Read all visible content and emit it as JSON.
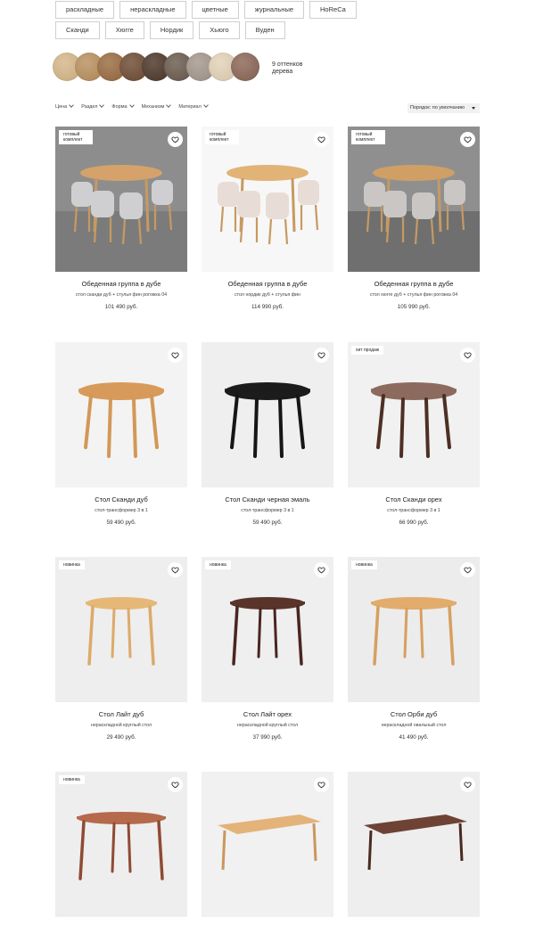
{
  "tags_row1": [
    "раскладные",
    "нераскладные",
    "цветные",
    "журнальные",
    "HoReCa"
  ],
  "tags_row2": [
    "Сканди",
    "Хюгге",
    "Нордик",
    "Хьюго",
    "Вуден"
  ],
  "swatches": {
    "colors": [
      "#d6b688",
      "#b98f5e",
      "#9a6b40",
      "#6e4b32",
      "#4c3628",
      "#6a5a4d",
      "#a3978c",
      "#e3d2b7",
      "#8b6656"
    ],
    "label": "9 оттенков дерева"
  },
  "filters": [
    "Цена",
    "Раздел",
    "Форма",
    "Механизм",
    "Материал"
  ],
  "sort": {
    "label": "Порядок: по умолчанию"
  },
  "products": [
    {
      "badge": "готовый комплект",
      "name": "Обеденная группа в дубе",
      "desc": "стол сканди дуб + стулья фин рогожка 04",
      "price": "101 490 руб."
    },
    {
      "badge": "готовый комплект",
      "name": "Обеденная группа в дубе",
      "desc": "стол нордик дуб + стулья фин",
      "price": "114 990 руб."
    },
    {
      "badge": "готовый комплект",
      "name": "Обеденная группа в дубе",
      "desc": "стол хюгге дуб + стулья фин рогожка 04",
      "price": "105 990 руб."
    },
    {
      "badge": "",
      "name": "Стол Сканди дуб",
      "desc": "стол-трансформер 3 в 1",
      "price": "59 490 руб."
    },
    {
      "badge": "",
      "name": "Стол Сканди черная эмаль",
      "desc": "стол-трансформер 3 в 1",
      "price": "59 490 руб."
    },
    {
      "badge": "хит продаж",
      "name": "Стол Сканди орех",
      "desc": "стол-трансформер 3 в 1",
      "price": "66 990 руб."
    },
    {
      "badge": "новинка",
      "name": "Стол Лайт дуб",
      "desc": "нераскладной круглый стол",
      "price": "29 490 руб."
    },
    {
      "badge": "новинка",
      "name": "Стол Лайт орех",
      "desc": "нераскладной круглый стол",
      "price": "37 990 руб."
    },
    {
      "badge": "новинка",
      "name": "Стол Орби дуб",
      "desc": "нераскладной овальный стол",
      "price": "41 490 руб."
    },
    {
      "badge": "новинка",
      "name": "",
      "desc": "",
      "price": ""
    },
    {
      "badge": "",
      "name": "",
      "desc": "",
      "price": ""
    },
    {
      "badge": "",
      "name": "",
      "desc": "",
      "price": ""
    }
  ]
}
